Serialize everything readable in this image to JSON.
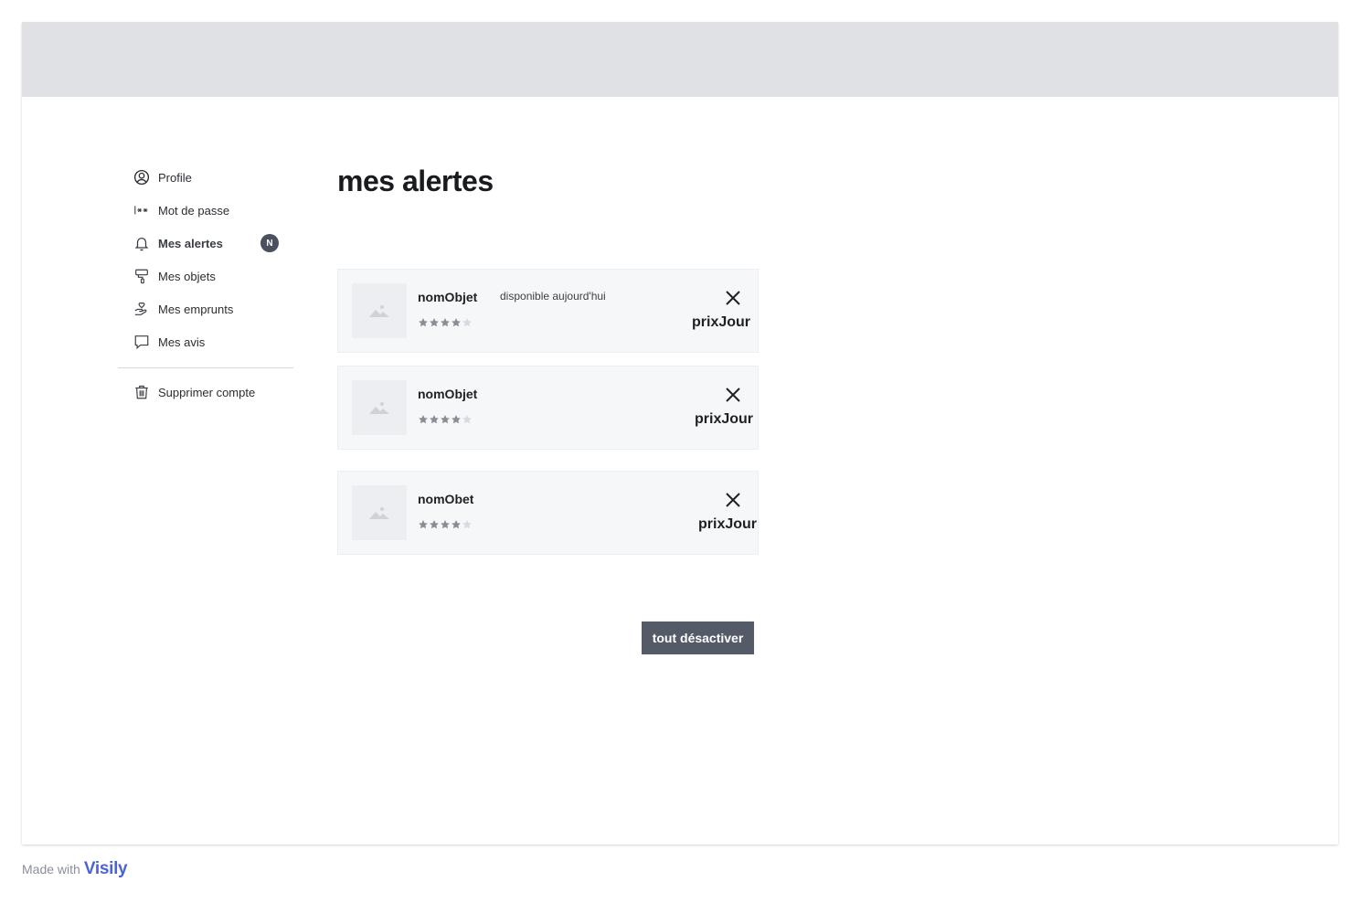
{
  "sidebar": {
    "items": [
      {
        "label": "Profile",
        "icon": "user-circle-icon"
      },
      {
        "label": "Mot de passe",
        "icon": "password-icon"
      },
      {
        "label": "Mes alertes",
        "icon": "bell-icon",
        "badge": "N"
      },
      {
        "label": "Mes objets",
        "icon": "paint-roller-icon"
      },
      {
        "label": "Mes emprunts",
        "icon": "hand-heart-icon"
      },
      {
        "label": "Mes avis",
        "icon": "chat-bubble-icon"
      }
    ],
    "delete_account": {
      "label": "Supprimer compte",
      "icon": "trash-icon"
    }
  },
  "main": {
    "title": "mes alertes",
    "alerts": [
      {
        "name": "nomObjet",
        "status": "disponible aujourd'hui",
        "price": "prixJour",
        "rating": 4
      },
      {
        "name": "nomObjet",
        "status": "",
        "price": "prixJour",
        "rating": 4
      },
      {
        "name": "nomObet",
        "status": "",
        "price": "prixJour",
        "rating": 4
      }
    ],
    "disable_all_label": "tout désactiver"
  },
  "footer": {
    "made_with": "Made with",
    "brand": "Visily"
  },
  "colors": {
    "topbar": "#dfe1e5",
    "button": "#555a69",
    "card": "#f6f7f9",
    "brand": "#4b63d8"
  }
}
